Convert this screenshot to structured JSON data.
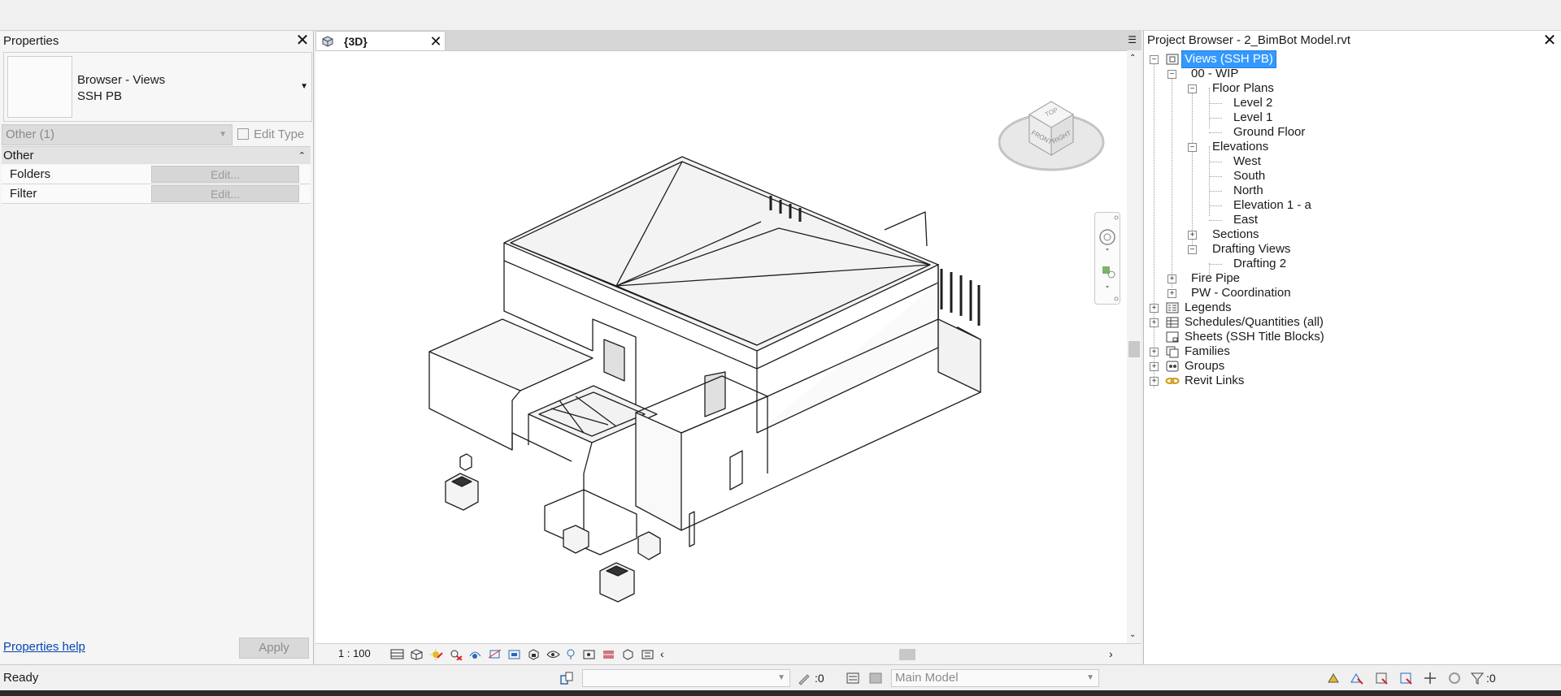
{
  "properties": {
    "title": "Properties",
    "type_name_line1": "Browser - Views",
    "type_name_line2": "SSH PB",
    "filter_value": "Other (1)",
    "edit_type_label": "Edit Type",
    "group_header": "Other",
    "rows": [
      {
        "name": "Folders",
        "value": "Edit..."
      },
      {
        "name": "Filter",
        "value": "Edit..."
      }
    ],
    "help_link": "Properties help",
    "apply_label": "Apply"
  },
  "view": {
    "tab_label": "{3D}",
    "scale": "1 : 100",
    "viewcube": {
      "top": "TOP",
      "front": "FRONT",
      "right": "RIGHT"
    }
  },
  "browser": {
    "title": "Project Browser - 2_BimBot Model.rvt",
    "root": "Views (SSH PB)",
    "wip": "00 - WIP",
    "floor_plans": "Floor Plans",
    "floor_plan_items": [
      "Level 2",
      "Level 1",
      "Ground Floor"
    ],
    "elevations": "Elevations",
    "elevation_items": [
      "West",
      "South",
      "North",
      "Elevation 1 - a",
      "East"
    ],
    "sections": "Sections",
    "drafting_views": "Drafting Views",
    "drafting_items": [
      "Drafting 2"
    ],
    "fire_pipe": "Fire Pipe",
    "pw_coordination": "PW - Coordination",
    "legends": "Legends",
    "schedules": "Schedules/Quantities (all)",
    "sheets": "Sheets (SSH Title Blocks)",
    "families": "Families",
    "groups": "Groups",
    "revit_links": "Revit Links"
  },
  "status": {
    "ready": "Ready",
    "workset_value": "",
    "editable_count": ":0",
    "model": "Main Model",
    "filter_count": ":0"
  },
  "colors": {
    "selection": "#3399ff",
    "link": "#0645ad",
    "panel_bg": "#f5f5f5"
  }
}
